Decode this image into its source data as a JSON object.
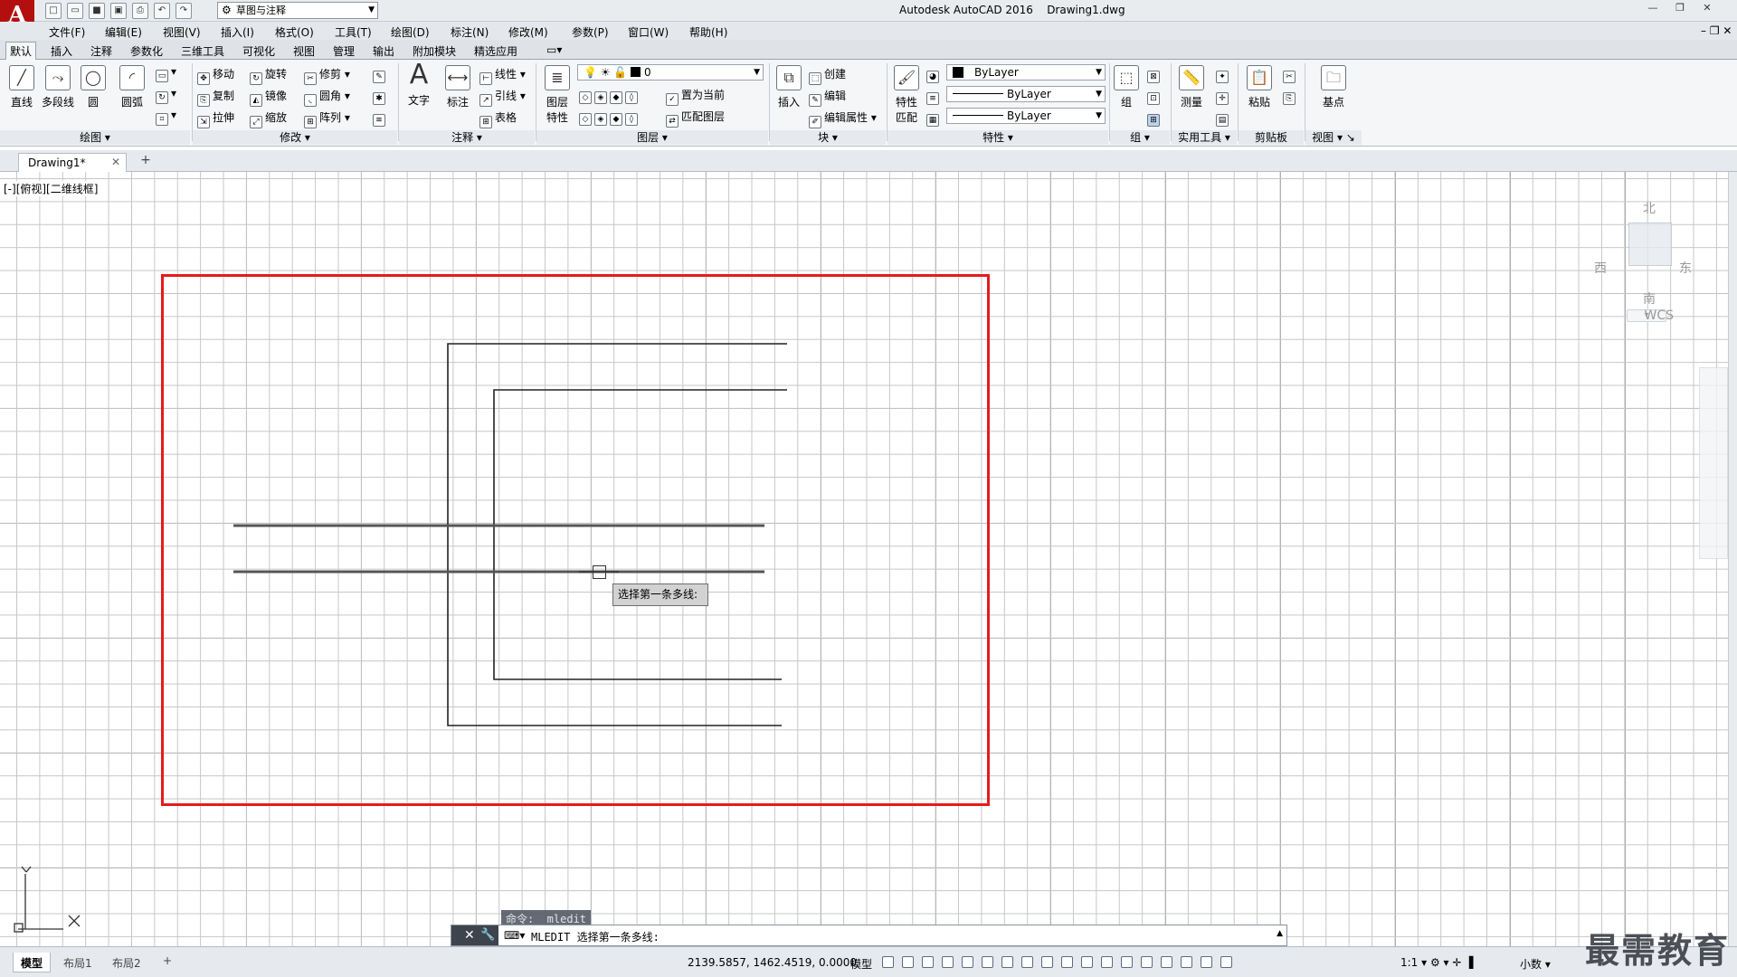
{
  "title_bar": {
    "app_name": "Autodesk AutoCAD 2016",
    "file_name": "Drawing1.dwg",
    "logo_letter": "A",
    "workspace": "草图与注释"
  },
  "menu": [
    "文件(F)",
    "编辑(E)",
    "视图(V)",
    "插入(I)",
    "格式(O)",
    "工具(T)",
    "绘图(D)",
    "标注(N)",
    "修改(M)",
    "参数(P)",
    "窗口(W)",
    "帮助(H)"
  ],
  "ribbon_tabs": [
    "默认",
    "插入",
    "注释",
    "参数化",
    "三维工具",
    "可视化",
    "视图",
    "管理",
    "输出",
    "附加模块",
    "精选应用"
  ],
  "ribbon": {
    "draw": {
      "label": "绘图",
      "line": "直线",
      "polyline": "多段线",
      "circle": "圆",
      "arc": "圆弧"
    },
    "modify": {
      "label": "修改",
      "move": "移动",
      "rotate": "旋转",
      "trim": "修剪",
      "copy": "复制",
      "mirror": "镜像",
      "fillet": "圆角",
      "stretch": "拉伸",
      "scale": "缩放",
      "array": "阵列"
    },
    "annotation": {
      "label": "注释",
      "text": "文字",
      "dimension": "标注",
      "linear": "线性",
      "leader": "引线",
      "table": "表格"
    },
    "layers": {
      "label": "图层",
      "properties_line1": "图层",
      "properties_line2": "特性",
      "current_layer": "0",
      "make_current": "置为当前",
      "match_layer": "匹配图层"
    },
    "block": {
      "label": "块",
      "insert": "插入",
      "create": "创建",
      "edit": "编辑",
      "edit_attributes": "编辑属性"
    },
    "properties": {
      "label": "特性",
      "match_line1": "特性",
      "match_line2": "匹配",
      "color": "ByLayer",
      "linetype": "ByLayer",
      "lineweight": "ByLayer"
    },
    "groups": {
      "label": "组",
      "group": "组"
    },
    "utilities": {
      "label": "实用工具",
      "measure": "测量"
    },
    "clipboard": {
      "label": "剪贴板",
      "paste": "粘贴"
    },
    "view": {
      "label": "视图",
      "base": "基点"
    }
  },
  "document_tab": {
    "name": "Drawing1*"
  },
  "viewport": {
    "label": "[-][俯视][二维线框]",
    "compass": {
      "north": "北",
      "south": "南",
      "east": "东",
      "west": "西"
    },
    "wcs": "WCS"
  },
  "tooltip": "选择第一条多线:",
  "command": {
    "history": "命令: _mledit",
    "current": "MLEDIT 选择第一条多线:"
  },
  "status": {
    "layout_tabs": [
      "模型",
      "布局1",
      "布局2"
    ],
    "coordinates": "2139.5857, 1462.4519, 0.0000",
    "space": "模型",
    "scale": "1:1",
    "units": "小数"
  },
  "watermark": "最需教育",
  "colors": {
    "frame": "#e51b1b",
    "logo_bg": "#b40f0f"
  }
}
